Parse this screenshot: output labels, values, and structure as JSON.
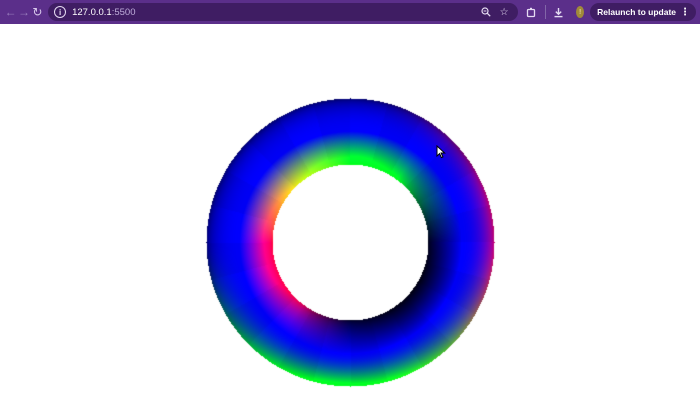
{
  "browser": {
    "url_host": "127.0.0.1",
    "url_port": ":5500",
    "relaunch_label": "Relaunch to update",
    "profile_initial": "!",
    "frame_color": "#5b2f8a",
    "omnibox_color": "#3f1d63"
  },
  "icons": {
    "back": "arrow-left-icon",
    "forward": "arrow-right-icon",
    "reload": "reload-icon",
    "site_info": "info-icon",
    "zoom": "zoom-icon",
    "bookmark": "star-icon",
    "extensions": "puzzle-icon",
    "download": "download-icon",
    "menu": "kebab-menu-icon"
  },
  "scene": {
    "object": "torus",
    "background": "#ffffff",
    "colors": [
      "#0000ff",
      "#00ff00",
      "#ff0000",
      "#ff00ff",
      "#000000"
    ]
  }
}
